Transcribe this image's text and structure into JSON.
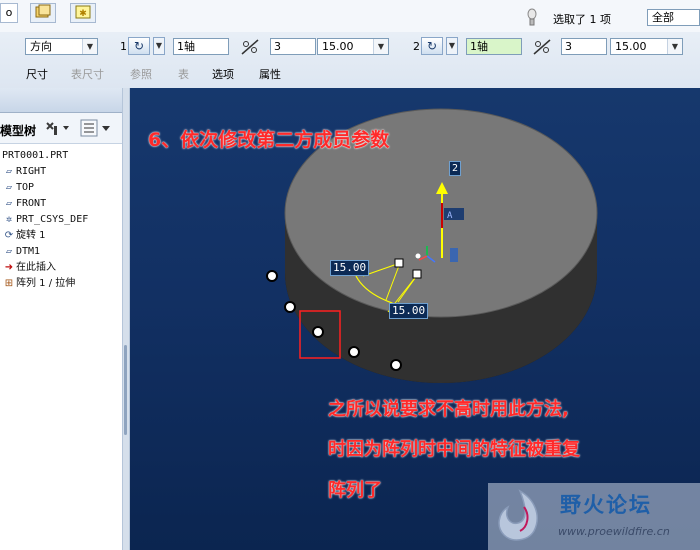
{
  "toolbar": {
    "selected_text": "选取了 1 项",
    "filter_value": "全部",
    "mode_value": "方向",
    "dir1": {
      "number": "1",
      "ref_value": "1轴",
      "count_value": "3",
      "angle_value": "15.00"
    },
    "dir2": {
      "number": "2",
      "ref_value": "1轴",
      "count_value": "3",
      "angle_value": "15.00"
    },
    "tabs": [
      {
        "label": "尺寸",
        "enabled": true
      },
      {
        "label": "表尺寸",
        "enabled": false
      },
      {
        "label": "参照",
        "enabled": false
      },
      {
        "label": "表",
        "enabled": false
      },
      {
        "label": "选项",
        "enabled": true
      },
      {
        "label": "属性",
        "enabled": true
      }
    ]
  },
  "left_panel": {
    "header_label": "模型树",
    "tree": [
      {
        "label": "PRT0001.PRT",
        "icon": "part-icon"
      },
      {
        "label": "RIGHT",
        "icon": "datum-plane-icon"
      },
      {
        "label": "TOP",
        "icon": "datum-plane-icon"
      },
      {
        "label": "FRONT",
        "icon": "datum-plane-icon"
      },
      {
        "label": "PRT_CSYS_DEF",
        "icon": "csys-icon"
      },
      {
        "label": "旋转 1",
        "icon": "revolve-icon"
      },
      {
        "label": "DTM1",
        "icon": "datum-plane-icon"
      },
      {
        "label": "在此插入",
        "icon": "insert-arrow-icon"
      },
      {
        "label": "阵列 1 / 拉伸",
        "icon": "pattern-icon"
      }
    ]
  },
  "viewport": {
    "title_annotation": "6、依次修改第二方成员参数",
    "dim_label_1": "15.00",
    "dim_label_2": "15.00",
    "axis_label": "2",
    "note_lines": [
      "之所以说要求不高时用此方法,",
      "时因为阵列时中间的特征被重复",
      "阵列了"
    ],
    "watermark_title": "野火论坛",
    "watermark_url": "www.proewildfire.cn"
  },
  "colors": {
    "annotation_red": "#ff2a2a",
    "viewport_bg": "#123063",
    "cylinder_top": "#787878",
    "dim_yellow": "#ffff00",
    "watermark_blue": "#1f5fa8"
  }
}
